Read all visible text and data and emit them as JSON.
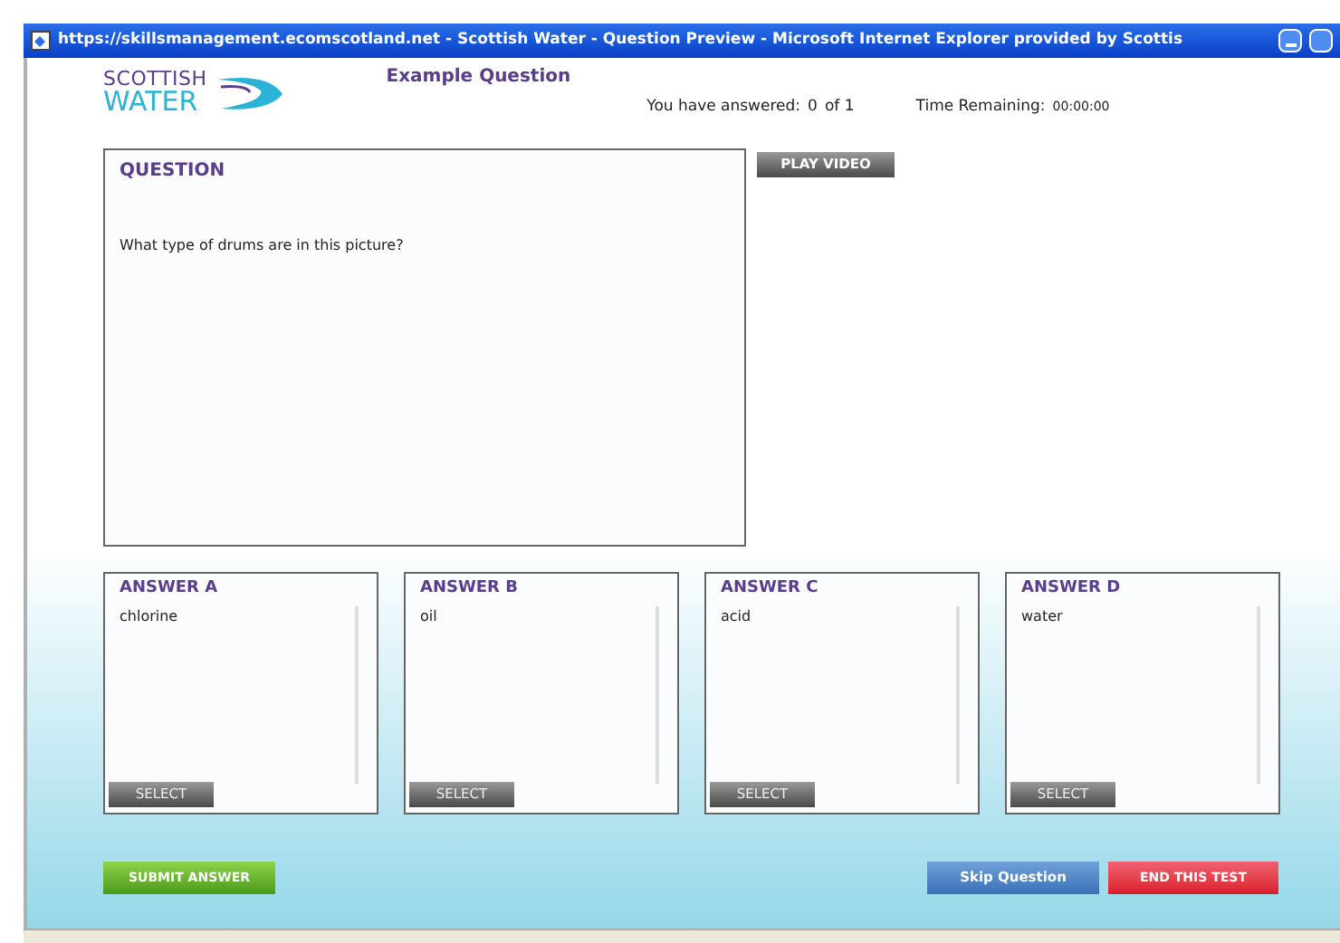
{
  "window": {
    "title": "https://skillsmanagement.ecomscotland.net - Scottish Water - Question Preview - Microsoft Internet Explorer provided by Scottis"
  },
  "logo": {
    "line_1": "SCOTTISH",
    "line_2": "WATER"
  },
  "heading": "Example Question",
  "progress": {
    "label": "You have answered:",
    "count": "0",
    "total": "of 1"
  },
  "timer": {
    "label": "Time Remaining:",
    "value": "00:00:00"
  },
  "question": {
    "heading": "QUESTION",
    "text": "What type of drums are in this picture?"
  },
  "play_video": "PLAY VIDEO",
  "answers": [
    {
      "label": "ANSWER A",
      "text": "chlorine",
      "button": "SELECT"
    },
    {
      "label": "ANSWER B",
      "text": "oil",
      "button": "SELECT"
    },
    {
      "label": "ANSWER C",
      "text": "acid",
      "button": "SELECT"
    },
    {
      "label": "ANSWER D",
      "text": "water",
      "button": "SELECT"
    }
  ],
  "buttons": [
    {
      "kind": "submit",
      "label": "SUBMIT ANSWER"
    },
    {
      "kind": "skip",
      "label": "Skip Question"
    },
    {
      "kind": "end",
      "label": "END THIS TEST"
    }
  ]
}
